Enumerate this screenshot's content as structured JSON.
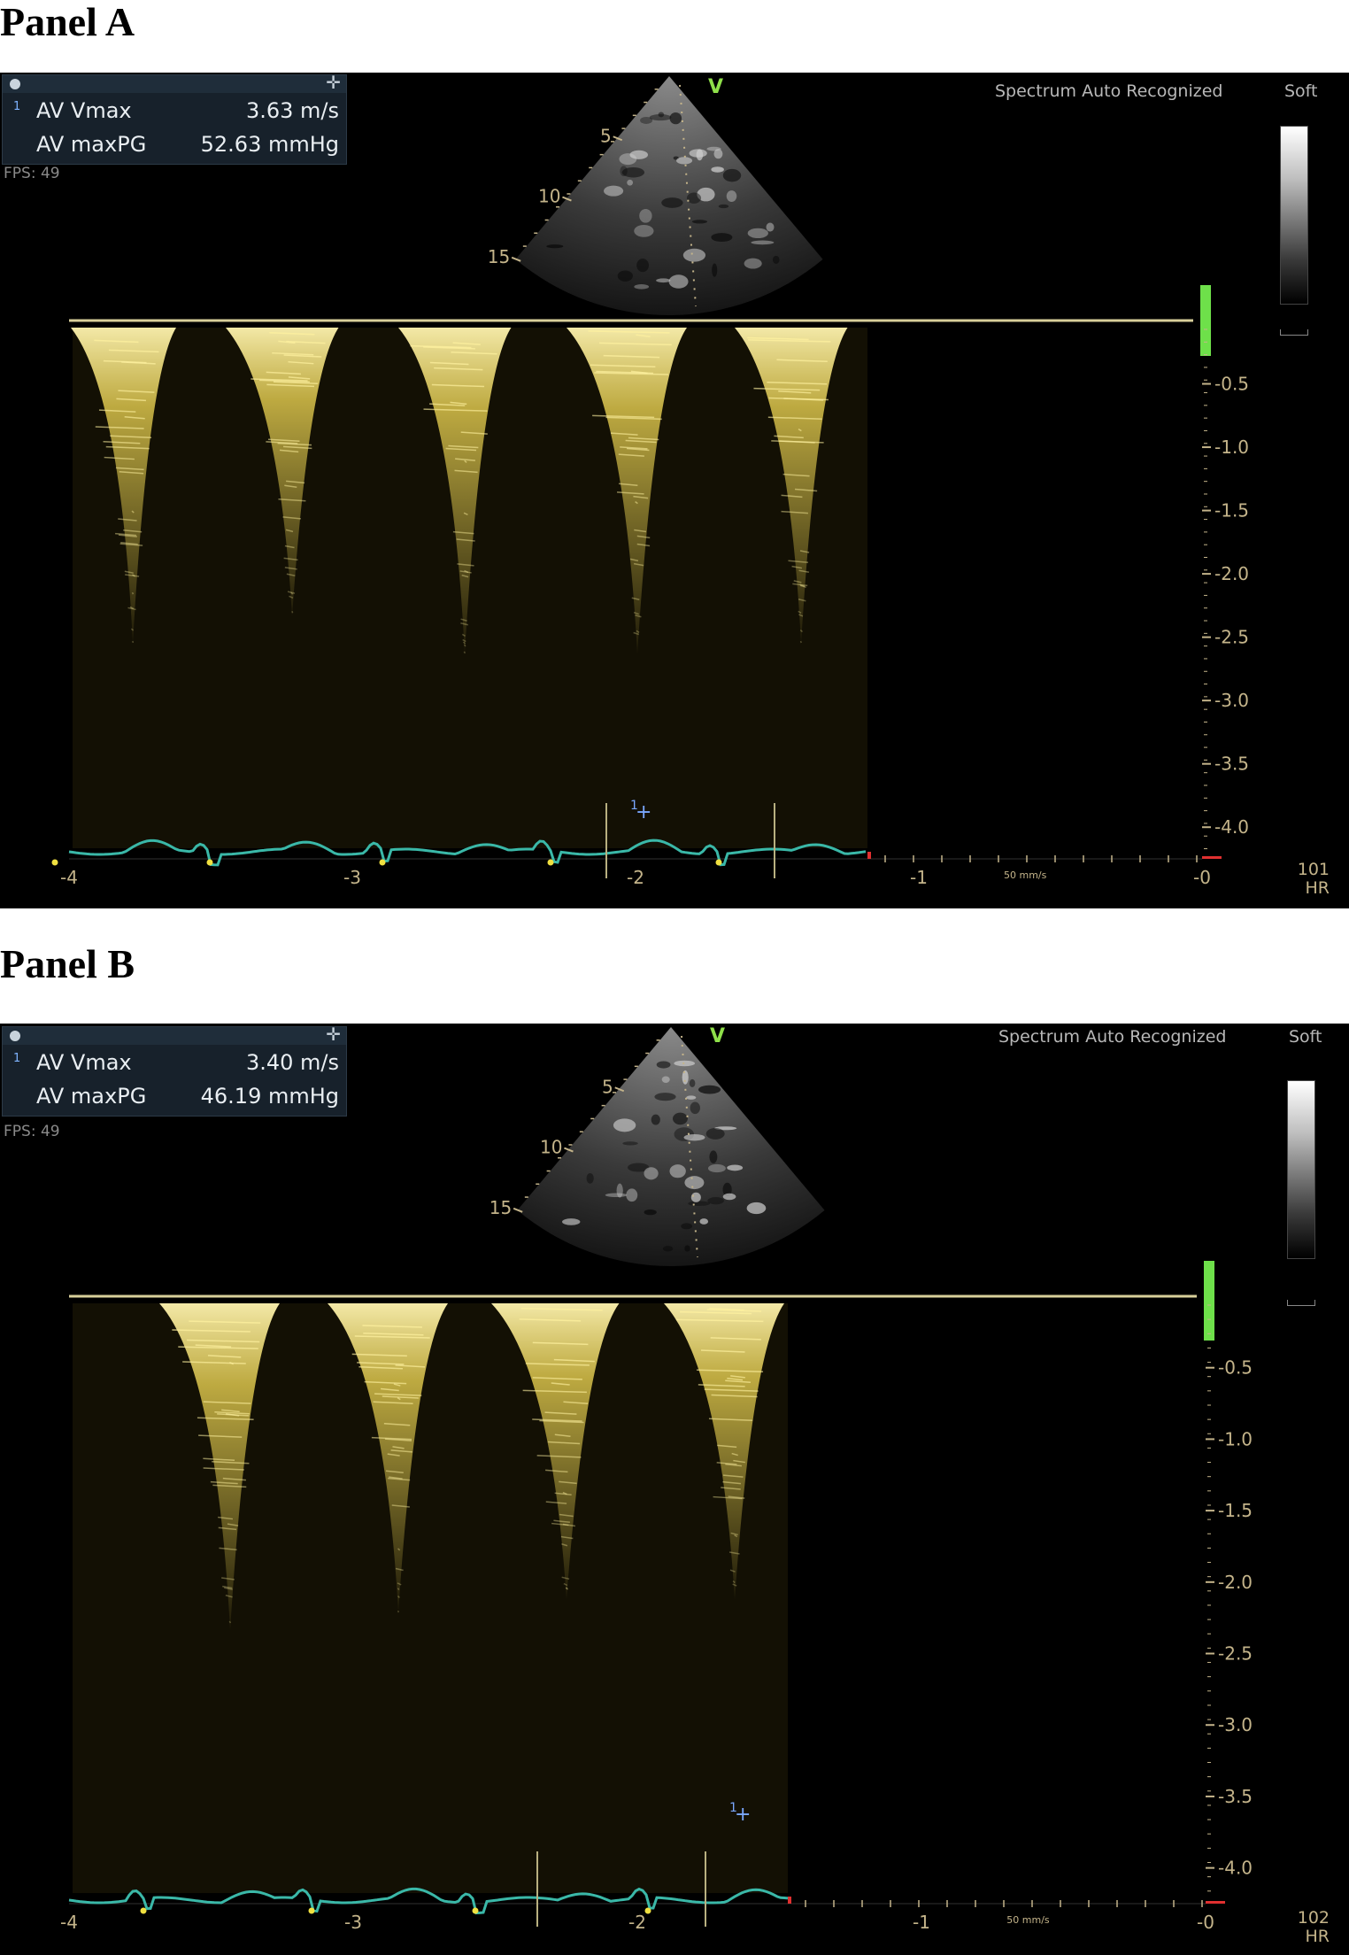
{
  "panels": [
    {
      "title": "Panel A",
      "measurements": [
        {
          "index": "1",
          "label": "AV Vmax",
          "value": "3.63 m/s"
        },
        {
          "index": "",
          "label": "AV maxPG",
          "value": "52.63 mmHg"
        }
      ],
      "fps": "FPS: 49",
      "spectrum_status": "Spectrum Auto Recognized",
      "map_label": "Soft",
      "view_marker": "V",
      "depth_marks": [
        "5",
        "10",
        "15"
      ],
      "velocity_ticks": [
        "-0.5",
        "-1.0",
        "-1.5",
        "-2.0",
        "-2.5",
        "-3.0",
        "-3.5",
        "-4.0"
      ],
      "time_ticks": [
        "-4",
        "-3",
        "-2",
        "-1",
        "-0"
      ],
      "sweep_speed": "50 mm/s",
      "heart_rate": "101",
      "heart_rate_label": "HR",
      "cursor_label": "1"
    },
    {
      "title": "Panel B",
      "measurements": [
        {
          "index": "1",
          "label": "AV Vmax",
          "value": "3.40 m/s"
        },
        {
          "index": "",
          "label": "AV maxPG",
          "value": "46.19 mmHg"
        }
      ],
      "fps": "FPS: 49",
      "spectrum_status": "Spectrum Auto Recognized",
      "map_label": "Soft",
      "view_marker": "V",
      "depth_marks": [
        "5",
        "10",
        "15"
      ],
      "velocity_ticks": [
        "-0.5",
        "-1.0",
        "-1.5",
        "-2.0",
        "-2.5",
        "-3.0",
        "-3.5",
        "-4.0"
      ],
      "time_ticks": [
        "-4",
        "-3",
        "-2",
        "-1",
        "-0"
      ],
      "sweep_speed": "50 mm/s",
      "heart_rate": "102",
      "heart_rate_label": "HR",
      "cursor_label": "1"
    }
  ],
  "colors": {
    "doppler": "#e8d050",
    "ecg": "#3ab8a8",
    "scale": "#c4b48a",
    "indicator": "#6ee04a"
  }
}
